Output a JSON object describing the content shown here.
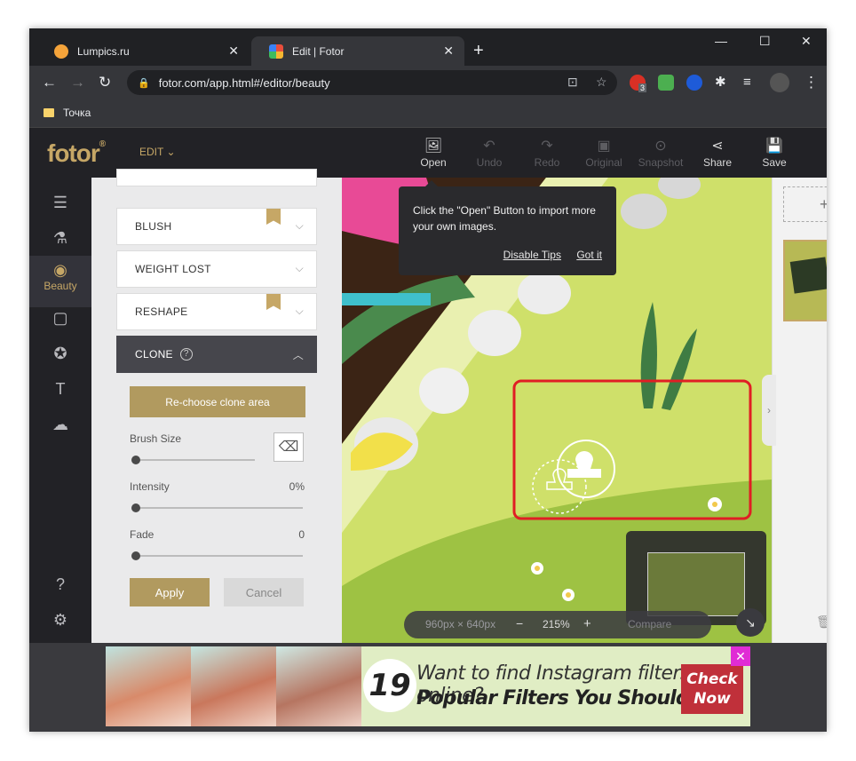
{
  "browser": {
    "tabs": [
      {
        "title": "Lumpics.ru",
        "favicon_color": "#f4a33a"
      },
      {
        "title": "Edit | Fotor",
        "favicon_color": "#e94e3c"
      }
    ],
    "url": "fotor.com/app.html#/editor/beauty",
    "bookmark": "Точка",
    "ext_badge": "3"
  },
  "header": {
    "logo": "fotor",
    "logo_mark": "®",
    "edit_menu": "EDIT",
    "actions": [
      {
        "label": "Open",
        "icon": "image-icon",
        "enabled": true
      },
      {
        "label": "Undo",
        "icon": "undo-icon",
        "enabled": false
      },
      {
        "label": "Redo",
        "icon": "redo-icon",
        "enabled": false
      },
      {
        "label": "Original",
        "icon": "original-icon",
        "enabled": false
      },
      {
        "label": "Snapshot",
        "icon": "snapshot-icon",
        "enabled": false
      },
      {
        "label": "Share",
        "icon": "share-icon",
        "enabled": true
      },
      {
        "label": "Save",
        "icon": "save-icon",
        "enabled": true
      }
    ]
  },
  "rail": {
    "active_label": "Beauty"
  },
  "panel": {
    "items": [
      "BLUSH",
      "WEIGHT LOST",
      "RESHAPE"
    ],
    "clone": {
      "title": "CLONE",
      "rechoose": "Re-choose clone area",
      "brush_size_label": "Brush Size",
      "intensity_label": "Intensity",
      "intensity_value": "0%",
      "fade_label": "Fade",
      "fade_value": "0",
      "apply": "Apply",
      "cancel": "Cancel"
    }
  },
  "tooltip": {
    "text": "Click the \"Open\" Button to import more your own images.",
    "disable": "Disable Tips",
    "gotit": "Got it"
  },
  "zoom": {
    "size": "960px × 640px",
    "minus": "−",
    "level": "215%",
    "plus": "+",
    "compare": "Compare"
  },
  "ad": {
    "number": "19",
    "line1": "Want to find Instagram filters online?",
    "line2": "Popular Filters You Should Try",
    "cta": "Check Now"
  },
  "colors": {
    "accent": "#c6a766",
    "selection": "#e01e24"
  }
}
